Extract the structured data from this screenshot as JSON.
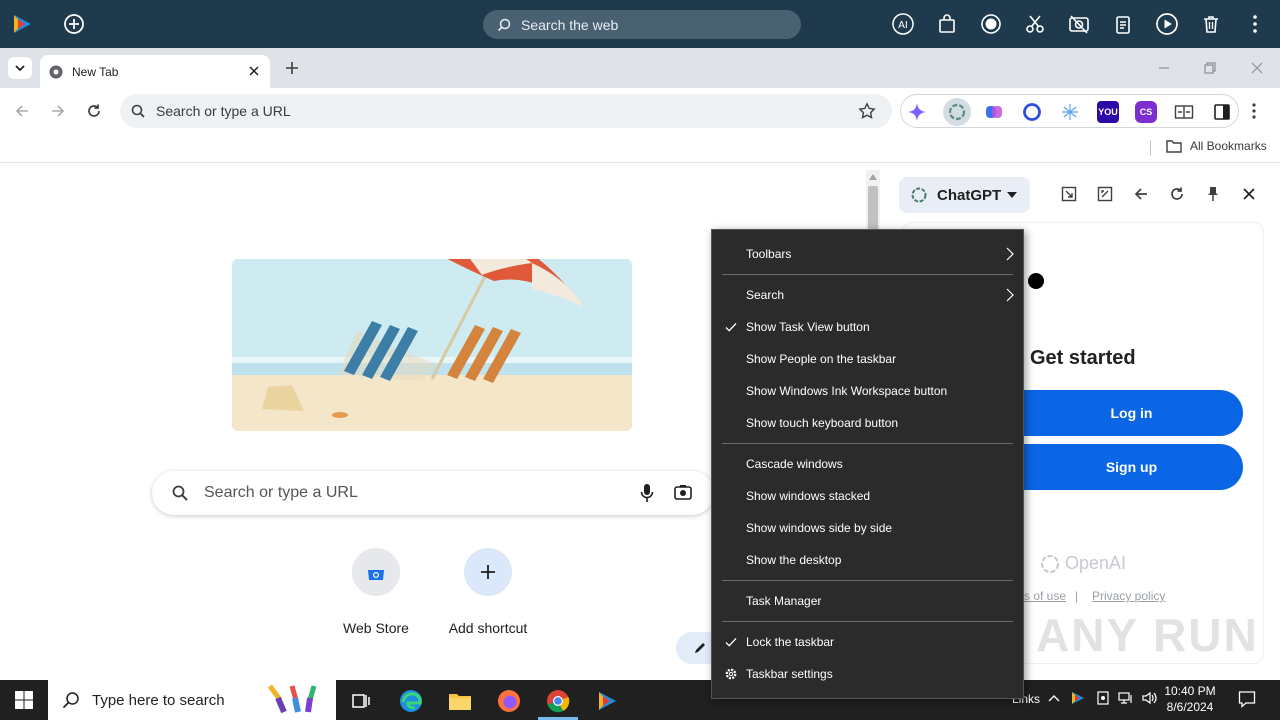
{
  "topbar": {
    "search_placeholder": "Search the web"
  },
  "tab": {
    "title": "New Tab"
  },
  "omnibox": {
    "placeholder": "Search or type a URL"
  },
  "bookmarks": {
    "all_label": "All Bookmarks"
  },
  "ntp": {
    "search_placeholder": "Search or type a URL",
    "shortcuts": [
      {
        "label": "Web Store"
      },
      {
        "label": "Add shortcut"
      }
    ]
  },
  "side_panel": {
    "selector_label": "ChatGPT",
    "heading": "Get started",
    "login_label": "Log in",
    "signup_label": "Sign up",
    "brand": "OpenAI",
    "terms_label": "s of use",
    "separator": "|",
    "privacy_label": "Privacy policy",
    "watermark": "ANY RUN"
  },
  "context_menu": {
    "items": [
      {
        "label": "Toolbars",
        "submenu": true,
        "checked": false
      },
      {
        "label": "Search",
        "submenu": true,
        "checked": false
      },
      {
        "label": "Show Task View button",
        "submenu": false,
        "checked": true
      },
      {
        "label": "Show People on the taskbar",
        "submenu": false,
        "checked": false
      },
      {
        "label": "Show Windows Ink Workspace button",
        "submenu": false,
        "checked": false
      },
      {
        "label": "Show touch keyboard button",
        "submenu": false,
        "checked": false
      },
      {
        "label": "Cascade windows",
        "submenu": false,
        "checked": false
      },
      {
        "label": "Show windows stacked",
        "submenu": false,
        "checked": false
      },
      {
        "label": "Show windows side by side",
        "submenu": false,
        "checked": false
      },
      {
        "label": "Show the desktop",
        "submenu": false,
        "checked": false
      },
      {
        "label": "Task Manager",
        "submenu": false,
        "checked": false
      },
      {
        "label": "Lock the taskbar",
        "submenu": false,
        "checked": true
      },
      {
        "label": "Taskbar settings",
        "submenu": false,
        "checked": false
      }
    ]
  },
  "taskbar": {
    "search_placeholder": "Type here to search",
    "links_label": "Links",
    "time": "10:40 PM",
    "date": "8/6/2024"
  },
  "colors": {
    "topbar": "#1e3a4c",
    "menu_bg": "#2b2b2b",
    "gpt_button": "#0a66e4",
    "taskbar": "#202020"
  }
}
